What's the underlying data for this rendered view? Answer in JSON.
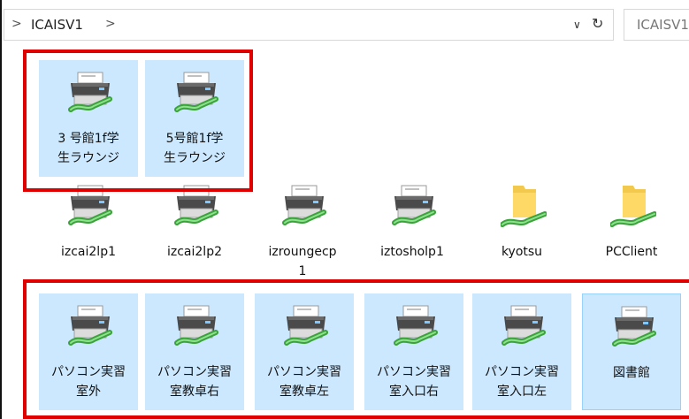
{
  "address_bar": {
    "crumb_left_glyph": ">",
    "crumb": "ICAISV1",
    "crumb_sep_glyph": ">",
    "dropdown_glyph": "∨",
    "refresh_glyph": "↻"
  },
  "search": {
    "text": "ICAISV1"
  },
  "groups": {
    "top": [
      {
        "label": "3 号館1f学\n生ラウンジ",
        "icon": "printer-icon"
      },
      {
        "label": "5号館1f学\n生ラウンジ",
        "icon": "printer-icon"
      }
    ],
    "middle": [
      {
        "label": "izcai2lp1",
        "icon": "printer-icon"
      },
      {
        "label": "izcai2lp2",
        "icon": "printer-icon"
      },
      {
        "label": "izroungecp\n1",
        "icon": "printer-icon"
      },
      {
        "label": "iztosholp1",
        "icon": "printer-icon"
      },
      {
        "label": "kyotsu",
        "icon": "shared-folder-icon"
      },
      {
        "label": "PCClient",
        "icon": "shared-folder-icon"
      }
    ],
    "bottom": [
      {
        "label": "パソコン実習\n室外",
        "icon": "printer-icon"
      },
      {
        "label": "パソコン実習\n室教卓右",
        "icon": "printer-icon"
      },
      {
        "label": "パソコン実習\n室教卓左",
        "icon": "printer-icon"
      },
      {
        "label": "パソコン実習\n室入口右",
        "icon": "printer-icon"
      },
      {
        "label": "パソコン実習\n室入口左",
        "icon": "printer-icon"
      },
      {
        "label": "図書館",
        "icon": "printer-icon"
      }
    ]
  },
  "colors": {
    "selection": "#cce8ff",
    "highlight_box": "#e00000"
  }
}
